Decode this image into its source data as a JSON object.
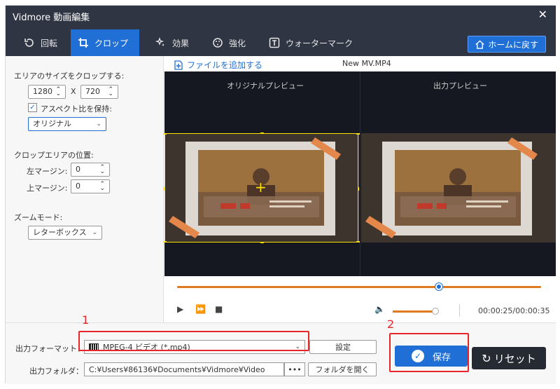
{
  "window": {
    "title": "Vidmore 動画編集",
    "close_glyph": "✕"
  },
  "tabs": [
    {
      "label": "回転",
      "icon": "rotate-icon"
    },
    {
      "label": "クロップ",
      "icon": "crop-icon",
      "active": true
    },
    {
      "label": "効果",
      "icon": "effect-icon"
    },
    {
      "label": "強化",
      "icon": "enhance-icon"
    },
    {
      "label": "ウォーターマーク",
      "icon": "watermark-icon"
    }
  ],
  "home_button": {
    "label": "ホームに戻す",
    "icon": "home-icon"
  },
  "crop_panel": {
    "size_label": "エリアのサイズをクロップする:",
    "width": "1280",
    "times": "X",
    "height": "720",
    "keep_aspect_label": "アスペクト比を保持:",
    "keep_aspect_checked": true,
    "aspect_value": "オリジナル",
    "position_label": "クロップエリアの位置:",
    "left_margin_label": "左マージン:",
    "left_margin_value": "0",
    "top_margin_label": "上マージン:",
    "top_margin_value": "0",
    "zoom_label": "ズームモード:",
    "zoom_value": "レターボックス"
  },
  "preview": {
    "add_file_label": "ファイルを追加する",
    "filename": "New MV.MP4",
    "original_label": "オリジナルプレビュー",
    "output_label": "出力プレビュー"
  },
  "playback": {
    "seek_progress": 0.72,
    "volume_level": 0.9,
    "timecode": "00:00:25/00:00:35"
  },
  "output": {
    "format_label": "出力フォーマット：",
    "format_value": "MPEG-4 ビデオ (*.mp4)",
    "settings_button": "設定",
    "folder_label": "出力フォルダ：",
    "folder_path": "C:¥Users¥86136¥Documents¥Vidmore¥Video",
    "browse_button": "•••",
    "open_folder_button": "フォルダを開く",
    "save_button": "保存",
    "reset_button": "リセット"
  },
  "annotations": {
    "one": "1",
    "two": "2"
  },
  "colors": {
    "accent": "#1f6fd6",
    "toolbar": "#2f3542",
    "timeline": "#e07a1f",
    "annotation": "#e8262a"
  }
}
